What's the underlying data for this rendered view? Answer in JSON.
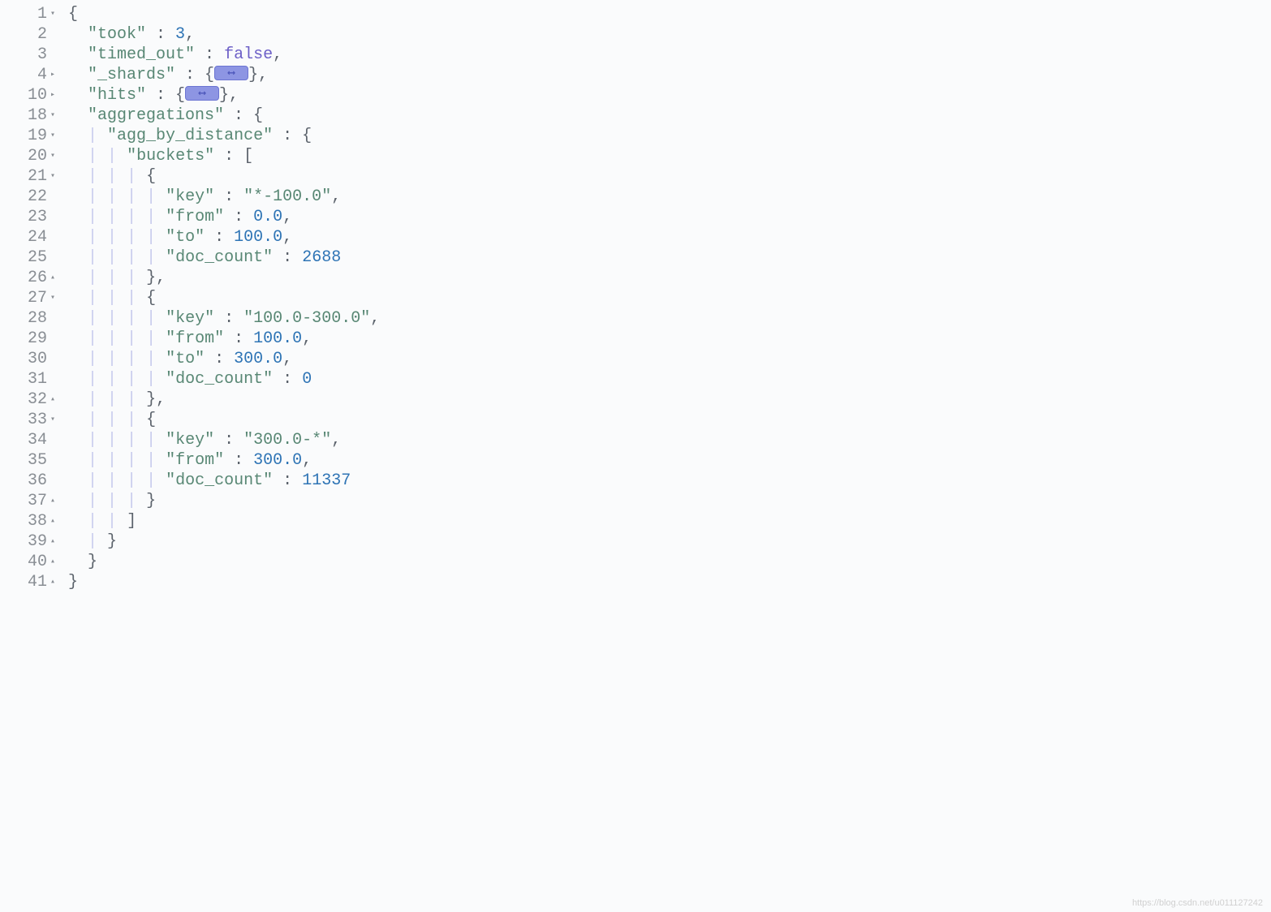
{
  "watermark": "https://blog.csdn.net/u011127242",
  "lines": [
    {
      "n": "1",
      "fold": "▾"
    },
    {
      "n": "2",
      "fold": ""
    },
    {
      "n": "3",
      "fold": ""
    },
    {
      "n": "4",
      "fold": "▸"
    },
    {
      "n": "10",
      "fold": "▸"
    },
    {
      "n": "18",
      "fold": "▾"
    },
    {
      "n": "19",
      "fold": "▾"
    },
    {
      "n": "20",
      "fold": "▾"
    },
    {
      "n": "21",
      "fold": "▾"
    },
    {
      "n": "22",
      "fold": ""
    },
    {
      "n": "23",
      "fold": ""
    },
    {
      "n": "24",
      "fold": ""
    },
    {
      "n": "25",
      "fold": ""
    },
    {
      "n": "26",
      "fold": "▴"
    },
    {
      "n": "27",
      "fold": "▾"
    },
    {
      "n": "28",
      "fold": ""
    },
    {
      "n": "29",
      "fold": ""
    },
    {
      "n": "30",
      "fold": ""
    },
    {
      "n": "31",
      "fold": ""
    },
    {
      "n": "32",
      "fold": "▴"
    },
    {
      "n": "33",
      "fold": "▾"
    },
    {
      "n": "34",
      "fold": ""
    },
    {
      "n": "35",
      "fold": ""
    },
    {
      "n": "36",
      "fold": ""
    },
    {
      "n": "37",
      "fold": "▴"
    },
    {
      "n": "38",
      "fold": "▴"
    },
    {
      "n": "39",
      "fold": "▴"
    },
    {
      "n": "40",
      "fold": "▴"
    },
    {
      "n": "41",
      "fold": "▴"
    }
  ],
  "code": {
    "took_key": "\"took\"",
    "took_val": "3",
    "timed_out_key": "\"timed_out\"",
    "timed_out_val": "false",
    "shards_key": "\"_shards\"",
    "hits_key": "\"hits\"",
    "aggregations_key": "\"aggregations\"",
    "agg_by_distance_key": "\"agg_by_distance\"",
    "buckets_key": "\"buckets\"",
    "b1_key": "\"*-100.0\"",
    "b1_from": "0.0",
    "b1_to": "100.0",
    "b1_doc": "2688",
    "b2_key": "\"100.0-300.0\"",
    "b2_from": "100.0",
    "b2_to": "300.0",
    "b2_doc": "0",
    "b3_key": "\"300.0-*\"",
    "b3_from": "300.0",
    "b3_doc": "11337",
    "key_lbl": "\"key\"",
    "from_lbl": "\"from\"",
    "to_lbl": "\"to\"",
    "doc_lbl": "\"doc_count\""
  }
}
